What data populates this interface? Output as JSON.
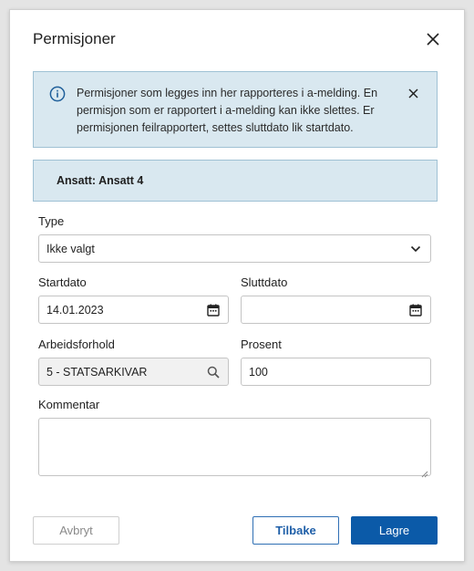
{
  "dialog": {
    "title": "Permisjoner",
    "close_icon": "close-icon"
  },
  "info_banner": {
    "icon": "info-icon",
    "text": "Permisjoner som legges inn her rapporteres i a-melding. En permisjon som er rapportert i a-melding kan ikke slettes. Er permisjonen feilrapportert, settes sluttdato lik startdato.",
    "close_icon": "close-icon"
  },
  "employee": {
    "text": "Ansatt: Ansatt 4"
  },
  "form": {
    "type": {
      "label": "Type",
      "value": "Ikke valgt",
      "icon": "chevron-down-icon"
    },
    "startdato": {
      "label": "Startdato",
      "value": "14.01.2023",
      "icon": "calendar-icon"
    },
    "sluttdato": {
      "label": "Sluttdato",
      "value": "",
      "icon": "calendar-icon"
    },
    "arbeidsforhold": {
      "label": "Arbeidsforhold",
      "value": "5 - STATSARKIVAR",
      "icon": "search-icon"
    },
    "prosent": {
      "label": "Prosent",
      "value": "100"
    },
    "kommentar": {
      "label": "Kommentar",
      "value": ""
    }
  },
  "buttons": {
    "cancel": "Avbryt",
    "back": "Tilbake",
    "save": "Lagre"
  },
  "colors": {
    "primary": "#0b5aa8",
    "info_bg": "#d9e8f0",
    "info_border": "#9fc1d4"
  }
}
